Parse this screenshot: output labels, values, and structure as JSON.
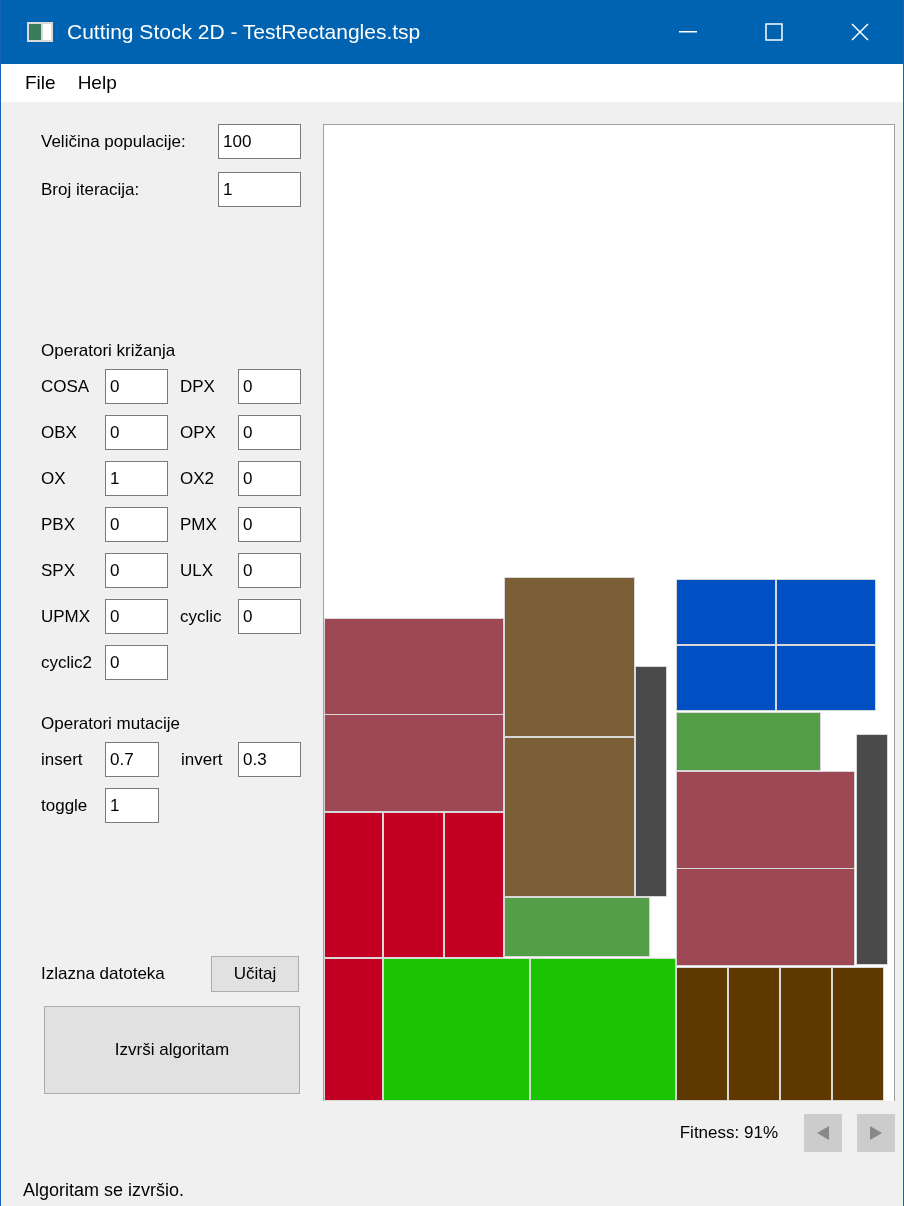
{
  "window": {
    "title": "Cutting Stock 2D - TestRectangles.tsp"
  },
  "menu": [
    "File",
    "Help"
  ],
  "params": [
    {
      "label": "Veličina populacije:",
      "value": "100"
    },
    {
      "label": "Broj iteracija:",
      "value": "1"
    }
  ],
  "crossover": {
    "title": "Operatori križanja",
    "operators": [
      {
        "label": "COSA",
        "value": "0"
      },
      {
        "label": "DPX",
        "value": "0"
      },
      {
        "label": "OBX",
        "value": "0"
      },
      {
        "label": "OPX",
        "value": "0"
      },
      {
        "label": "OX",
        "value": "1"
      },
      {
        "label": "OX2",
        "value": "0"
      },
      {
        "label": "PBX",
        "value": "0"
      },
      {
        "label": "PMX",
        "value": "0"
      },
      {
        "label": "SPX",
        "value": "0"
      },
      {
        "label": "ULX",
        "value": "0"
      },
      {
        "label": "UPMX",
        "value": "0"
      },
      {
        "label": "cyclic",
        "value": "0"
      },
      {
        "label": "cyclic2",
        "value": "0"
      }
    ]
  },
  "mutation": {
    "title": "Operatori mutacije",
    "operators": [
      {
        "label": "insert",
        "value": "0.7"
      },
      {
        "label": "invert",
        "value": "0.3"
      },
      {
        "label": "toggle",
        "value": "1"
      }
    ]
  },
  "output": {
    "label": "Izlazna datoteka",
    "button": "Učitaj"
  },
  "run_button": "Izvrši algoritam",
  "layout": {
    "pieces": [
      {
        "color": "#9e4855"
      },
      {
        "color": "#9e4855"
      },
      {
        "color": "#c30023"
      },
      {
        "color": "#c30023"
      },
      {
        "color": "#c30023"
      },
      {
        "color": "#c30023"
      },
      {
        "color": "#1ac400"
      },
      {
        "color": "#1ac400"
      },
      {
        "color": "#7a5f36"
      },
      {
        "color": "#7a5f36"
      },
      {
        "color": "#4a4a4a"
      },
      {
        "color": "#559e48"
      },
      {
        "color": "#004fc3"
      },
      {
        "color": "#004fc3"
      },
      {
        "color": "#004fc3"
      },
      {
        "color": "#004fc3"
      },
      {
        "color": "#559e48"
      },
      {
        "color": "#9e4855"
      },
      {
        "color": "#9e4855"
      },
      {
        "color": "#4a4a4a"
      },
      {
        "color": "#5e3a00"
      },
      {
        "color": "#5e3a00"
      },
      {
        "color": "#5e3a00"
      },
      {
        "color": "#5e3a00"
      }
    ]
  },
  "fitness": "Fitness: 91%",
  "status": "Algoritam se izvršio."
}
